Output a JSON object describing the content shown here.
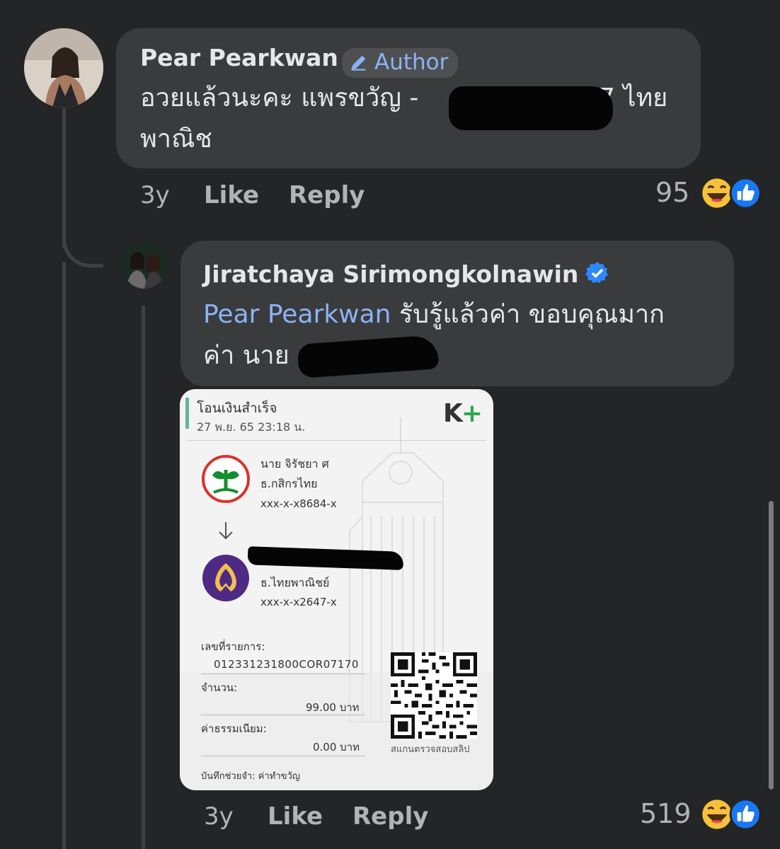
{
  "comments": [
    {
      "author": "Pear Pearkwan",
      "badge": "Author",
      "text_line1": "อวยแล้วนะคะ  แพรขวัญ -",
      "text_line1_tail": "7 ไทย",
      "text_line2": "พาณิช",
      "time": "3y",
      "like": "Like",
      "reply": "Reply",
      "reaction_count": "95"
    },
    {
      "author": "Jiratchaya Sirimongkolnawin",
      "verified": true,
      "mention": "Pear Pearkwan",
      "text_line1_rest": " รับรู้แล้วค่า ขอบคุณมาก",
      "text_line2": "ค่า นาย",
      "time": "3y",
      "like": "Like",
      "reply": "Reply",
      "reaction_count": "519"
    }
  ],
  "slip": {
    "title": "โอนเงินสำเร็จ",
    "datetime": "27 พ.ย. 65  23:18 น.",
    "brand": "K+",
    "sender_name": "นาย จิรัชยา ศ",
    "sender_bank": "ธ.กสิกรไทย",
    "sender_account": "xxx-x-x8684-x",
    "receiver_bank": "ธ.ไทยพาณิชย์",
    "receiver_account": "xxx-x-x2647-x",
    "ref_label": "เลขที่รายการ:",
    "ref_value": "012331231800COR07170",
    "amount_label": "จำนวน:",
    "amount_value": "99.00 บาท",
    "fee_label": "ค่าธรรมเนียม:",
    "fee_value": "0.00 บาท",
    "qr_caption": "สแกนตรวจสอบสลิป",
    "memo": "บันทึกช่วยจำ: ค่าทำขวัญ"
  },
  "colors": {
    "background": "#242526",
    "bubble": "#3a3b3c",
    "link": "#8cb3f6",
    "kbank_green": "#138f2d",
    "scb_purple": "#4e2a84"
  },
  "icons": [
    "pencil-icon",
    "verified-icon",
    "haha-reaction-icon",
    "like-reaction-icon",
    "arrow-down-icon",
    "qr-code"
  ]
}
